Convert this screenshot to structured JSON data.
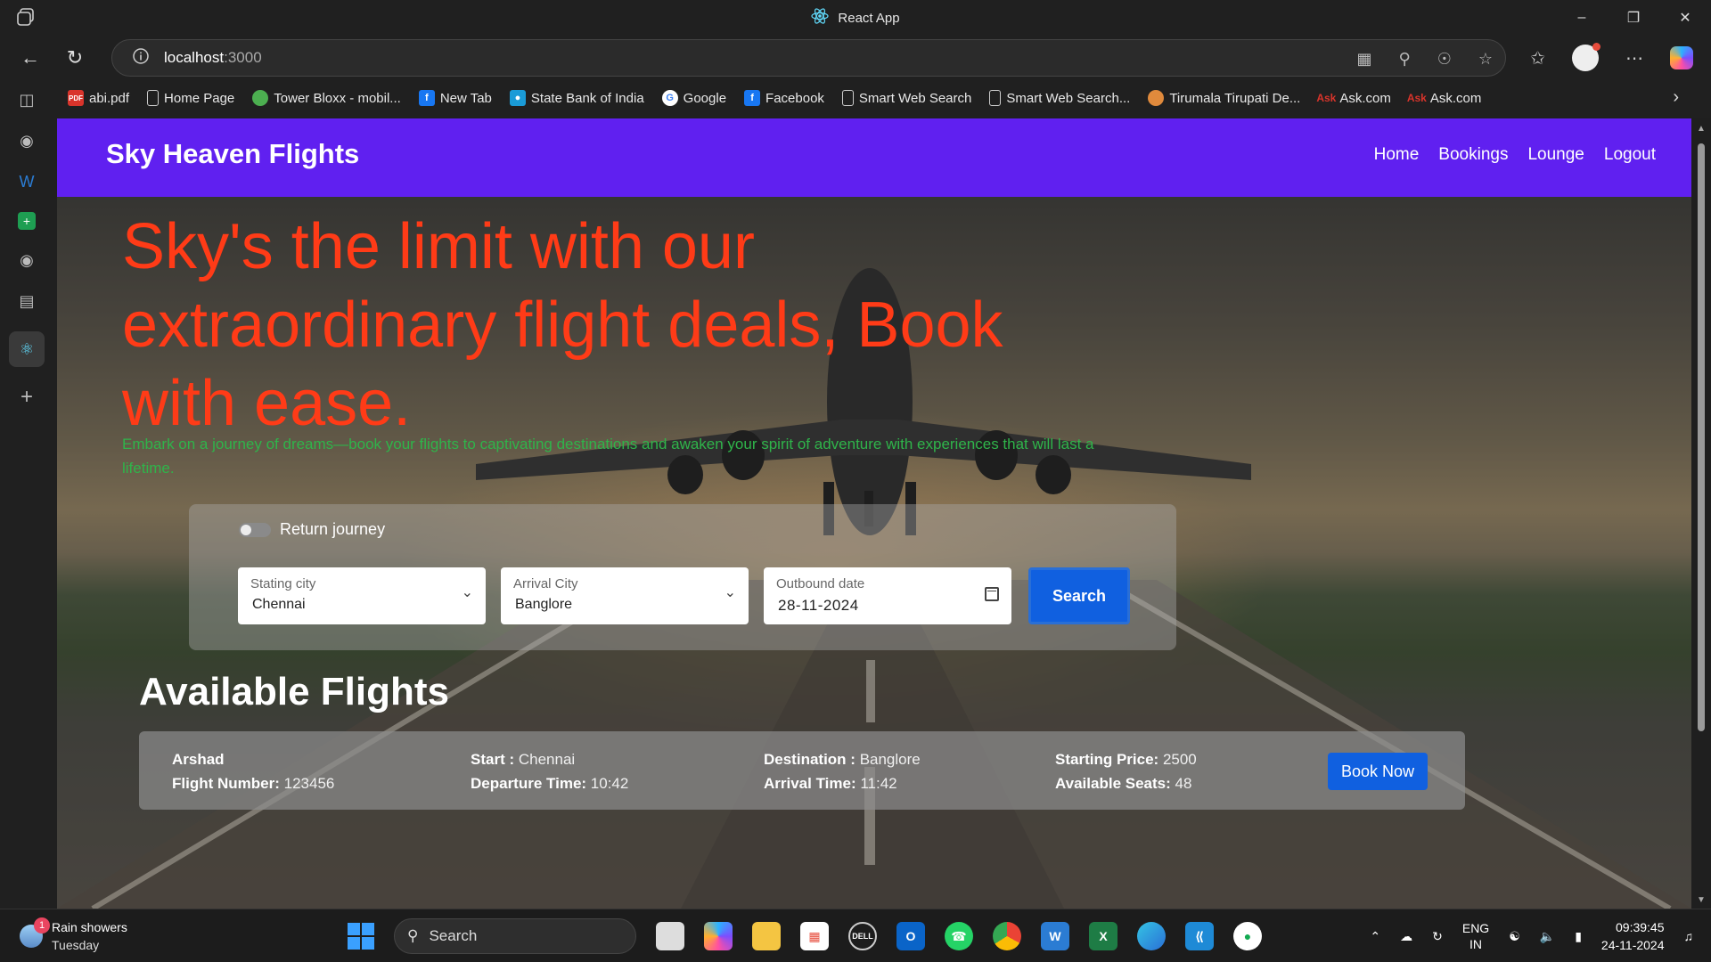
{
  "browser": {
    "tab_title": "React App",
    "url_host": "localhost",
    "url_port": ":3000",
    "bookmarks": [
      {
        "label": "abi.pdf",
        "icon": "pdf-icon",
        "color": "#d9342b"
      },
      {
        "label": "Home Page",
        "icon": "page-icon",
        "color": "#cccccc"
      },
      {
        "label": "Tower Bloxx - mobil...",
        "icon": "game-icon",
        "color": "#4caf50"
      },
      {
        "label": "New Tab",
        "icon": "facebook-icon",
        "color": "#1877f2"
      },
      {
        "label": "State Bank of India",
        "icon": "sbi-icon",
        "color": "#1a9bd7"
      },
      {
        "label": "Google",
        "icon": "google-icon",
        "color": "#ffffff"
      },
      {
        "label": "Facebook",
        "icon": "facebook-icon",
        "color": "#1877f2"
      },
      {
        "label": "Smart Web Search",
        "icon": "page-icon",
        "color": "#cccccc"
      },
      {
        "label": "Smart Web Search...",
        "icon": "page-icon",
        "color": "#cccccc"
      },
      {
        "label": "Tirumala Tirupati De...",
        "icon": "temple-icon",
        "color": "#e08a3c"
      },
      {
        "label": "Ask.com",
        "icon": "ask-icon",
        "color": "#d9342b"
      },
      {
        "label": "Ask.com",
        "icon": "ask-icon",
        "color": "#d9342b"
      }
    ]
  },
  "site": {
    "brand": "Sky Heaven Flights",
    "nav": [
      "Home",
      "Bookings",
      "Lounge",
      "Logout"
    ],
    "headline": "Sky's the limit with our extraordinary flight deals, Book with ease.",
    "subline": "Embark on a journey of dreams—book your flights to captivating destinations and awaken your spirit of adventure with experiences that will last a lifetime.",
    "colors": {
      "header": "#6020f0",
      "headline": "#ff3b17",
      "subline": "#2fb44a",
      "button": "#1060e0"
    }
  },
  "search": {
    "return_label": "Return journey",
    "return_enabled": false,
    "start_label": "Stating city",
    "start_value": "Chennai",
    "arrival_label": "Arrival City",
    "arrival_value": "Banglore",
    "date_label": "Outbound date",
    "date_value": "28-11-2024",
    "button": "Search"
  },
  "flights": {
    "title": "Available Flights",
    "items": [
      {
        "airline": "Arshad",
        "flight_number_label": "Flight Number:",
        "flight_number": "123456",
        "start_label": "Start :",
        "start": "Chennai",
        "departure_label": "Departure Time:",
        "departure": "10:42",
        "destination_label": "Destination :",
        "destination": "Banglore",
        "arrival_label": "Arrival Time:",
        "arrival": "11:42",
        "price_label": "Starting Price:",
        "price": "2500",
        "seats_label": "Available Seats:",
        "seats": "48",
        "button": "Book Now"
      }
    ]
  },
  "taskbar": {
    "weather_badge": "1",
    "weather_title": "Rain showers",
    "weather_sub": "Tuesday",
    "search_label": "Search",
    "lang_top": "ENG",
    "lang_bottom": "IN",
    "time": "09:39:45",
    "date": "24-11-2024"
  }
}
